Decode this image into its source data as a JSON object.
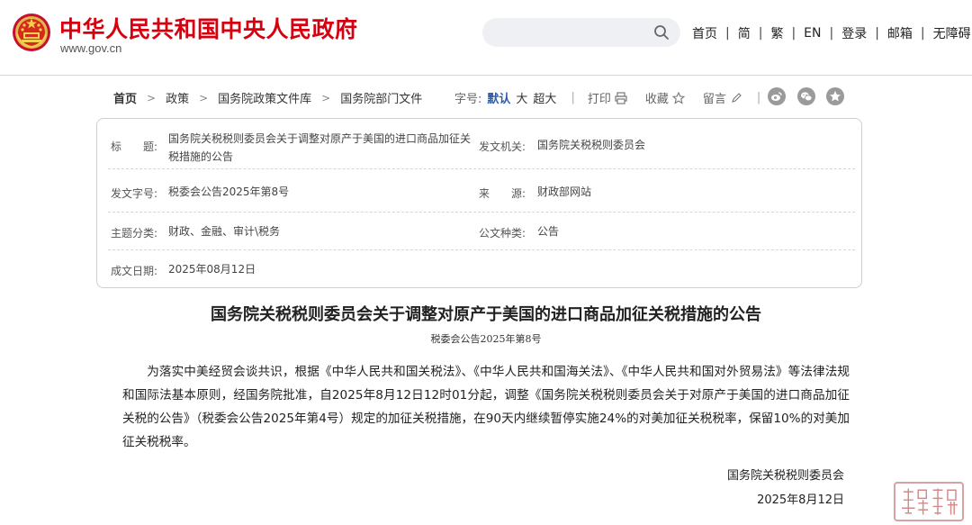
{
  "header": {
    "site_title": "中华人民共和国中央人民政府",
    "site_url": "www.gov.cn",
    "search_placeholder": "",
    "nav": [
      {
        "label": "首页"
      },
      {
        "label": "简"
      },
      {
        "label": "繁"
      },
      {
        "label": "EN"
      },
      {
        "label": "登录"
      },
      {
        "label": "邮箱"
      },
      {
        "label": "无障碍"
      }
    ]
  },
  "breadcrumb": [
    "首页",
    "政策",
    "国务院政策文件库",
    "国务院部门文件"
  ],
  "toolbar": {
    "font_size_label": "字号:",
    "font_sizes": [
      "默认",
      "大",
      "超大"
    ],
    "print_label": "打印",
    "favorite_label": "收藏",
    "comment_label": "留言",
    "share_icons": [
      "weibo-icon",
      "wechat-icon",
      "favorites-star-icon"
    ]
  },
  "info": {
    "title_label": "标　　题:",
    "title_value": "国务院关税税则委员会关于调整对原产于美国的进口商品加征关税措施的公告",
    "issuer_label": "发文机关:",
    "issuer_value": "国务院关税税则委员会",
    "doc_no_label": "发文字号:",
    "doc_no_value": "税委会公告2025年第8号",
    "source_label": "来　　源:",
    "source_value": "财政部网站",
    "topic_label": "主题分类:",
    "topic_value": "财政、金融、审计\\税务",
    "type_label": "公文种类:",
    "type_value": "公告",
    "date_label": "成文日期:",
    "date_value": "2025年08月12日"
  },
  "article": {
    "title": "国务院关税税则委员会关于调整对原产于美国的进口商品加征关税措施的公告",
    "doc_no": "税委会公告2025年第8号",
    "body": "为落实中美经贸会谈共识，根据《中华人民共和国关税法》、《中华人民共和国海关法》、《中华人民共和国对外贸易法》等法律法规和国际法基本原则，经国务院批准，自2025年8月12日12时01分起，调整《国务院关税税则委员会关于对原产于美国的进口商品加征关税的公告》（税委会公告2025年第4号）规定的加征关税措施，在90天内继续暂停实施24%的对美加征关税税率，保留10%的对美加征关税税率。",
    "signature_org": "国务院关税税则委员会",
    "signature_date": "2025年8月12日"
  },
  "colors": {
    "brand_red": "#d7000f",
    "active_font_size": "#2a5caa",
    "share_icon_gray": "#9a9a9a"
  }
}
